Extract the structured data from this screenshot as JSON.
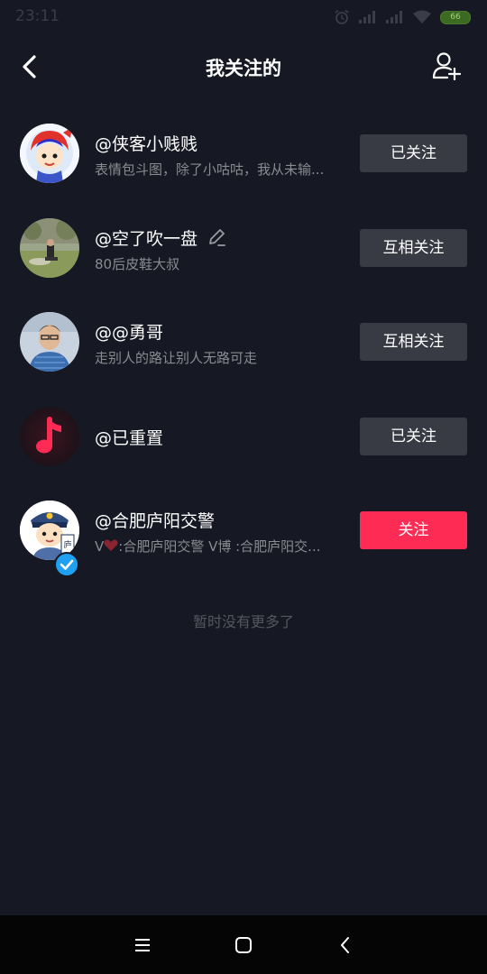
{
  "status": {
    "time": "23:11",
    "battery": "66"
  },
  "header": {
    "title": "我关注的"
  },
  "users": [
    {
      "name": "@侠客小贱贱",
      "desc": "表情包斗图，除了小咕咕，我从未输...",
      "button": "已关注"
    },
    {
      "name": "@空了吹一盘",
      "desc": "80后皮鞋大叔",
      "button": "互相关注"
    },
    {
      "name": "@@勇哥",
      "desc": "走别人的路让别人无路可走",
      "button": "互相关注"
    },
    {
      "name": "@已重置",
      "desc": "",
      "button": "已关注"
    },
    {
      "name": "@合肥庐阳交警",
      "desc_prefix": "V",
      "desc": ":合肥庐阳交警 V博 :合肥庐阳交...",
      "button": "关注"
    }
  ],
  "footer": {
    "no_more": "暂时没有更多了"
  },
  "colors": {
    "background": "#161823",
    "accent": "#fe2c55",
    "button_gray": "#393b44"
  },
  "icons": [
    "back-arrow-icon",
    "add-user-icon",
    "edit-pencil-icon",
    "verified-badge-icon",
    "heart-icon",
    "menu-icon",
    "home-square-icon",
    "back-triangle-icon",
    "alarm-icon",
    "signal-icon",
    "wifi-icon"
  ]
}
